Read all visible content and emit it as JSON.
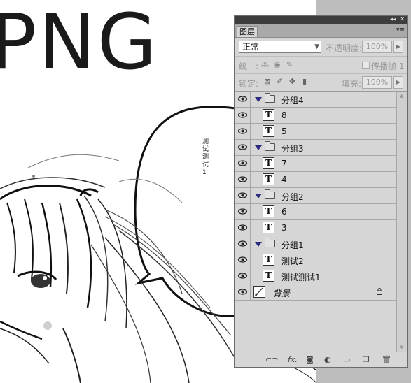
{
  "canvas": {
    "big_text": "PNG",
    "bubble_text": "测试测试1"
  },
  "panel": {
    "collapse_icon": "◂◂",
    "close_icon": "✕",
    "tab_label": "图层",
    "menu_icon": "▾≡",
    "blend_mode": "正常",
    "opacity_label": "不透明度:",
    "opacity_value": "100%",
    "unify_label": "统一:",
    "propagate_label": "传播帧 1",
    "lock_label": "锁定:",
    "fill_label": "填充:",
    "fill_value": "100%",
    "layers": [
      {
        "name": "分组4",
        "type": "group"
      },
      {
        "name": "8",
        "type": "text"
      },
      {
        "name": "5",
        "type": "text"
      },
      {
        "name": "分组3",
        "type": "group"
      },
      {
        "name": "7",
        "type": "text"
      },
      {
        "name": "4",
        "type": "text"
      },
      {
        "name": "分组2",
        "type": "group"
      },
      {
        "name": "6",
        "type": "text"
      },
      {
        "name": "3",
        "type": "text"
      },
      {
        "name": "分组1",
        "type": "group"
      },
      {
        "name": "测试2",
        "type": "text"
      },
      {
        "name": "测试测试1",
        "type": "text"
      },
      {
        "name": "背景",
        "type": "background"
      }
    ],
    "text_layer_glyph": "T",
    "bottom_icons": [
      "link-icon",
      "fx-icon",
      "mask-icon",
      "adjustment-icon",
      "new-group-icon",
      "new-layer-icon",
      "trash-icon"
    ],
    "fx_label": "fx."
  }
}
